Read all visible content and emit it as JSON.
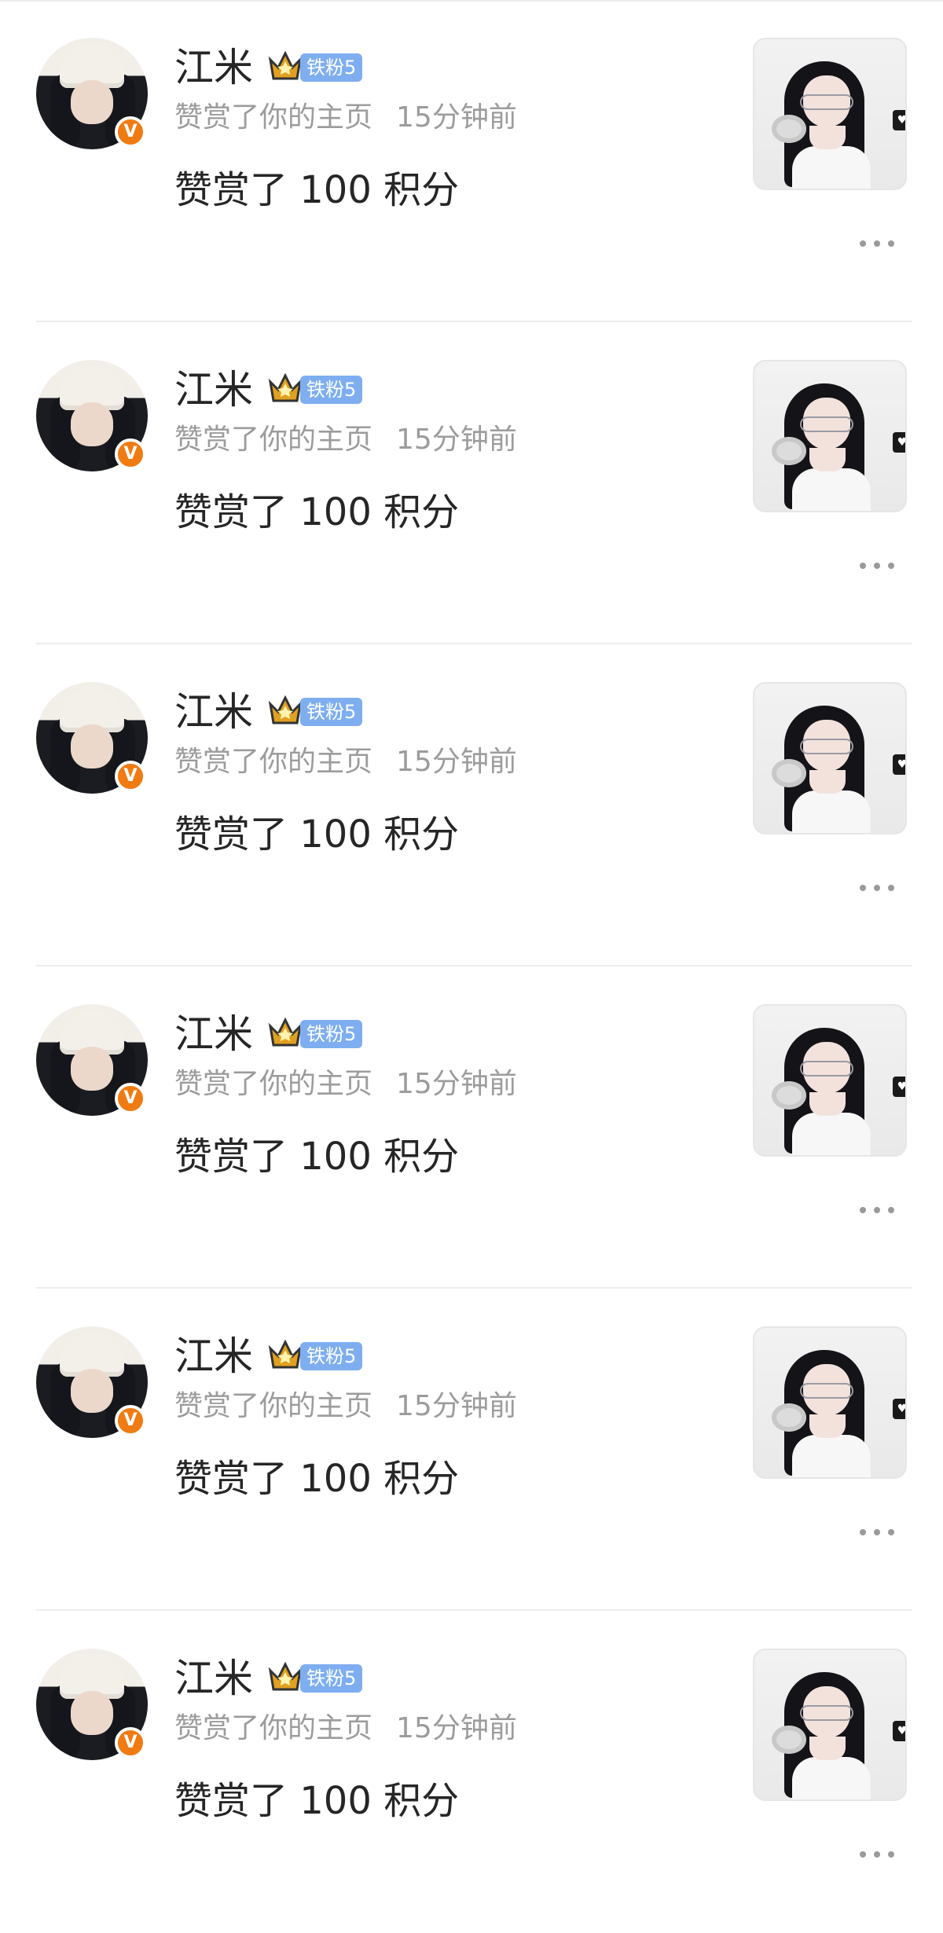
{
  "notifications": [
    {
      "user": "江米",
      "fan_badge": "铁粉5",
      "verified_mark": "V",
      "action": "赞赏了你的主页",
      "time": "15分钟前",
      "message": "赞赏了 100 积分",
      "thumb_tag": "♥"
    },
    {
      "user": "江米",
      "fan_badge": "铁粉5",
      "verified_mark": "V",
      "action": "赞赏了你的主页",
      "time": "15分钟前",
      "message": "赞赏了 100 积分",
      "thumb_tag": "♥"
    },
    {
      "user": "江米",
      "fan_badge": "铁粉5",
      "verified_mark": "V",
      "action": "赞赏了你的主页",
      "time": "15分钟前",
      "message": "赞赏了 100 积分",
      "thumb_tag": "♥"
    },
    {
      "user": "江米",
      "fan_badge": "铁粉5",
      "verified_mark": "V",
      "action": "赞赏了你的主页",
      "time": "15分钟前",
      "message": "赞赏了 100 积分",
      "thumb_tag": "♥"
    },
    {
      "user": "江米",
      "fan_badge": "铁粉5",
      "verified_mark": "V",
      "action": "赞赏了你的主页",
      "time": "15分钟前",
      "message": "赞赏了 100 积分",
      "thumb_tag": "♥"
    },
    {
      "user": "江米",
      "fan_badge": "铁粉5",
      "verified_mark": "V",
      "action": "赞赏了你的主页",
      "time": "15分钟前",
      "message": "赞赏了 100 积分",
      "thumb_tag": "♥"
    }
  ],
  "icons": {
    "avatar": "user-avatar-image",
    "verified": "verified-badge-icon",
    "crown": "crown-icon",
    "thumbnail": "post-thumbnail-image",
    "more": "more-options-icon"
  },
  "colors": {
    "verified_badge": "#f07b12",
    "fan_badge": "#7eaef0",
    "primary_text": "#262626",
    "secondary_text": "#9c9c9c",
    "divider": "#ededed"
  }
}
